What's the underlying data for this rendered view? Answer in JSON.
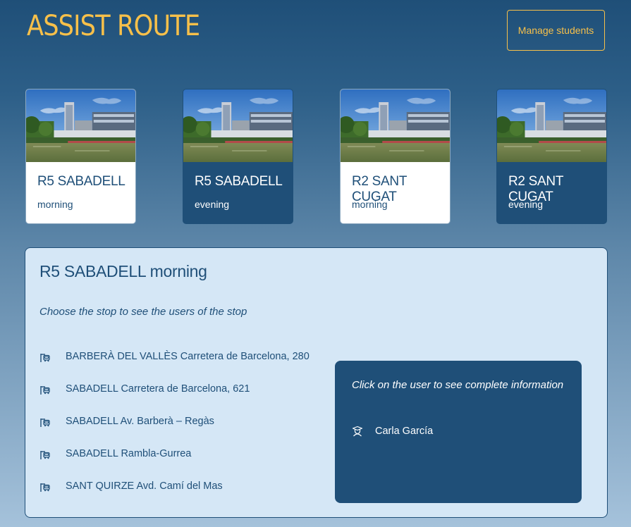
{
  "header": {
    "title": "ASSIST ROUTE",
    "manage_button": "Manage students"
  },
  "colors": {
    "accent": "#f7c04a",
    "primary": "#1f4f78",
    "panel_bg": "#d5e7f6"
  },
  "routes": [
    {
      "name": "R5 SABADELL",
      "time": "morning",
      "selected_style": "light"
    },
    {
      "name": "R5 SABADELL",
      "time": "evening",
      "selected_style": "dark"
    },
    {
      "name": "R2 SANT CUGAT",
      "time": "morning",
      "selected_style": "light"
    },
    {
      "name": "R2 SANT CUGAT",
      "time": "evening",
      "selected_style": "dark"
    }
  ],
  "detail": {
    "title": "R5 SABADELL morning",
    "hint": "Choose the stop to see the users of the stop",
    "stop_icon": "bus-stop-icon",
    "stops": [
      {
        "label": "BARBERÀ DEL VALLÈS Carretera de Barcelona, 280"
      },
      {
        "label": "SABADELL Carretera de Barcelona, 621"
      },
      {
        "label": "SABADELL Av. Barberà – Regàs"
      },
      {
        "label": "SABADELL Rambla-Gurrea"
      },
      {
        "label": "SANT QUIRZE Avd. Camí del Mas"
      }
    ],
    "users": {
      "hint": "Click on the user to see complete information",
      "user_icon": "student-icon",
      "items": [
        {
          "name": "Carla García"
        }
      ]
    }
  }
}
